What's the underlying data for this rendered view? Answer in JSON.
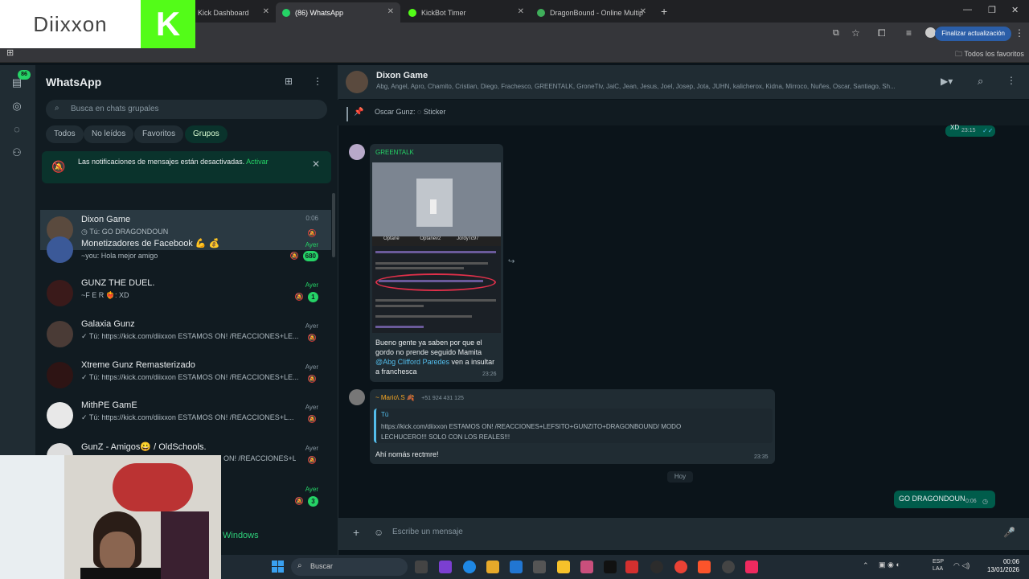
{
  "browser": {
    "tabs": [
      {
        "label": "Kick Dashboard"
      },
      {
        "label": "(86) WhatsApp"
      },
      {
        "label": "KickBot Timer"
      },
      {
        "label": "DragonBound - Online Multip"
      }
    ],
    "update_label": "Finalizar actualización",
    "bookmarks_label": "Todos los favoritos"
  },
  "overlay": {
    "logo_text": "Diixxon",
    "kick_letter": "K"
  },
  "sidebar": {
    "notif_count": "86"
  },
  "whatsapp": {
    "title": "WhatsApp",
    "search_placeholder": "Busca en chats grupales",
    "filters": [
      "Todos",
      "No leídos",
      "Favoritos",
      "Grupos"
    ],
    "notification": {
      "text": "Las notificaciones de mensajes están desactivadas.",
      "action": "Activar"
    },
    "chats": [
      {
        "name": "Dixon Game",
        "preview": "Tú: GO DRAGONDOUN",
        "time": "0:06"
      },
      {
        "name": "Monetizadores de Facebook 💪 💰",
        "preview": "~you: Hola mejor amigo",
        "time": "Ayer",
        "badge": "680"
      },
      {
        "name": "GUNZ THE DUEL.",
        "preview": "~F E R ❤️‍🔥: XD",
        "time": "Ayer",
        "badge": "1"
      },
      {
        "name": "Galaxia Gunz",
        "preview": "✓ Tú: https://kick.com/diixxon ESTAMOS ON! /REACCIONES+LE...",
        "time": "Ayer"
      },
      {
        "name": "Xtreme Gunz Remasterizado",
        "preview": "✓ Tú: https://kick.com/diixxon ESTAMOS ON! /REACCIONES+LE...",
        "time": "Ayer"
      },
      {
        "name": "MithPE GamE",
        "preview": "✓ Tú: https://kick.com/diixxon ESTAMOS ON! /REACCIONES+L...",
        "time": "Ayer"
      },
      {
        "name": "GunZ - Amigos😀 / OldSchools.",
        "preview": "ON! /REACCIONES+L...",
        "time": "Ayer"
      },
      {
        "name": "",
        "preview": "",
        "time": "Ayer",
        "badge": "3"
      }
    ]
  },
  "chat": {
    "name": "Dixon Game",
    "members": "Abg, Angel, Apro, Chamito, Cristian, Diego, Frachesco, GREENTALK, GroneTlv, JaiC, Jean, Jesus, Joel, Josep, Jota, JUHN, kalicherox, Kidna, Mirroco, Nuñes, Oscar, Santiago, Sh...",
    "pinned": {
      "sender": "Oscar Gunz:",
      "text": "Sticker"
    },
    "top_tick": {
      "text": "XD",
      "time": "23:15"
    },
    "msg1": {
      "sender": "GREENTALK",
      "text": "Bueno gente ya saben por que el gordo no prende seguido Mamita",
      "mention": "@Abg Clifford Paredes",
      "text_after": "ven a insultar a franchesca",
      "time": "23:26",
      "image_lines": [
        "Optane",
        "Optanev2",
        "JordyTc97"
      ]
    },
    "msg2": {
      "sender": "~ Mario\\.S 🍂",
      "phone": "+51 924 431 125",
      "quote_author": "Tú",
      "quote_text": "https://kick.com/diixxon ESTAMOS ON! /REACCIONES+LEFSITO+GUNZITO+DRAGONBOUND/ MODO LECHUCERO!!! SOLO CON LOS REALES!!!",
      "text": "Ahí nomás rectmre!",
      "time": "23:35"
    },
    "date_divider": "Hoy",
    "msg3": {
      "text": "GO DRAGONDOUN",
      "time": "0:06"
    },
    "composer_placeholder": "Escribe un mensaje"
  },
  "taskbar": {
    "search_label": "Buscar",
    "lang": "ESP",
    "lang2": "LAA",
    "time": "00:06",
    "date": "13/01/2026",
    "windows_label": "Windows"
  }
}
